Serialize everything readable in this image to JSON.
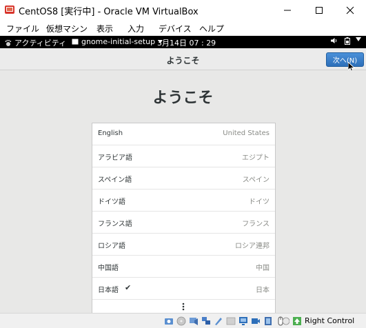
{
  "window": {
    "title": "CentOS8 [実行中] - Oracle VM VirtualBox"
  },
  "menu": {
    "items": [
      "ファイル",
      "仮想マシン",
      "表示",
      "入力",
      "デバイス",
      "ヘルプ"
    ]
  },
  "gnome_bar": {
    "activities": "アクティビティ",
    "app_menu": "gnome-initial-setup",
    "clock": "3月14日 07 : 29"
  },
  "setup": {
    "header_title": "ようこそ",
    "next_button": "次へ(N)",
    "heading": "ようこそ",
    "languages": [
      {
        "name": "English",
        "region": "United States",
        "selected": false
      },
      {
        "name": "アラビア語",
        "region": "エジプト",
        "selected": false
      },
      {
        "name": "スペイン語",
        "region": "スペイン",
        "selected": false
      },
      {
        "name": "ドイツ語",
        "region": "ドイツ",
        "selected": false
      },
      {
        "name": "フランス語",
        "region": "フランス",
        "selected": false
      },
      {
        "name": "ロシア語",
        "region": "ロシア連邦",
        "selected": false
      },
      {
        "name": "中国語",
        "region": "中国",
        "selected": false
      },
      {
        "name": "日本語",
        "region": "日本",
        "selected": true
      }
    ],
    "selected_mark": "✔"
  },
  "statusbar": {
    "host_key": "Right Control"
  },
  "colors": {
    "accent": "#2d6fb9",
    "gnome_bar": "#000000",
    "content_bg": "#e8e8e7"
  }
}
